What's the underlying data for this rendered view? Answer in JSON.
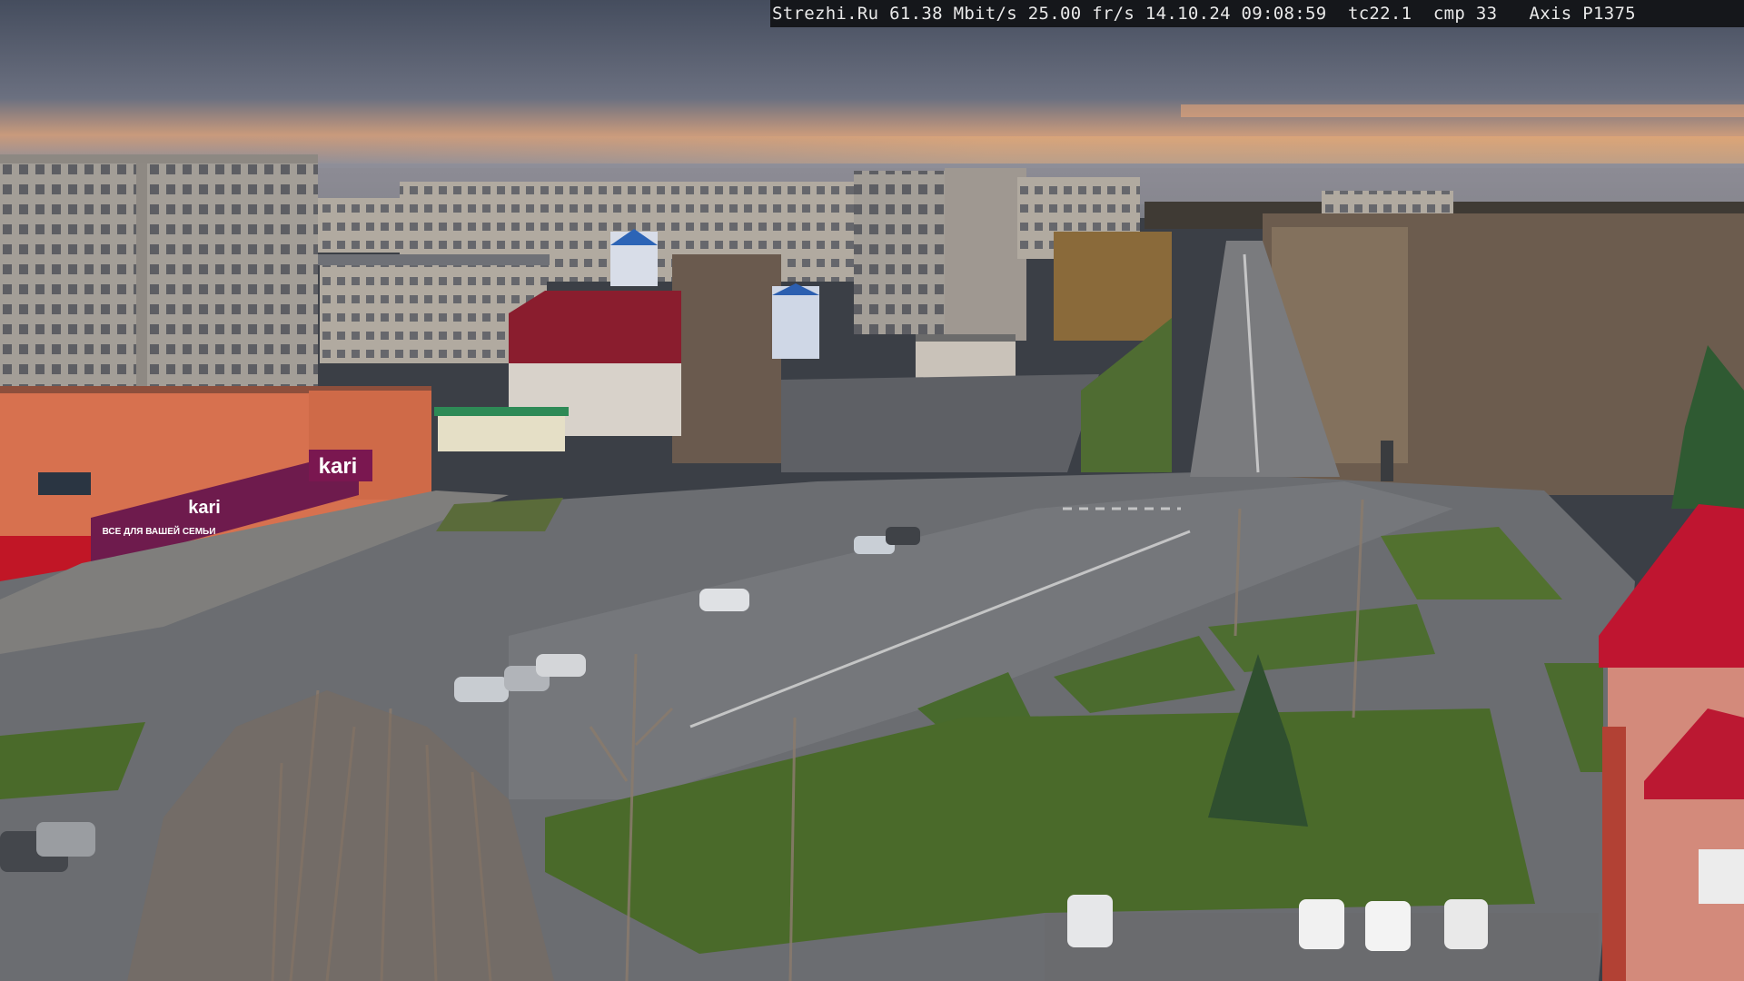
{
  "overlay": {
    "site": "Strezhi.Ru",
    "bitrate": "61.38 Mbit/s",
    "framerate": "25.00 fr/s",
    "timestamp": "14.10.24 09:08:59",
    "tc": "tc22.1",
    "cmp": "cmp 33",
    "camera": "Axis P1375"
  },
  "signs": {
    "store_brand": "kari",
    "store_brand_small": "kari",
    "store_tagline": "ВСЕ ДЛЯ ВАШЕЙ СЕМЬИ"
  },
  "colors": {
    "sky_top": "#4d5566",
    "sky_glow": "#e9b07a",
    "road": "#6e7074",
    "grass": "#4f6b2e",
    "roof_red": "#c31f35",
    "store_magenta": "#7d1f56"
  }
}
